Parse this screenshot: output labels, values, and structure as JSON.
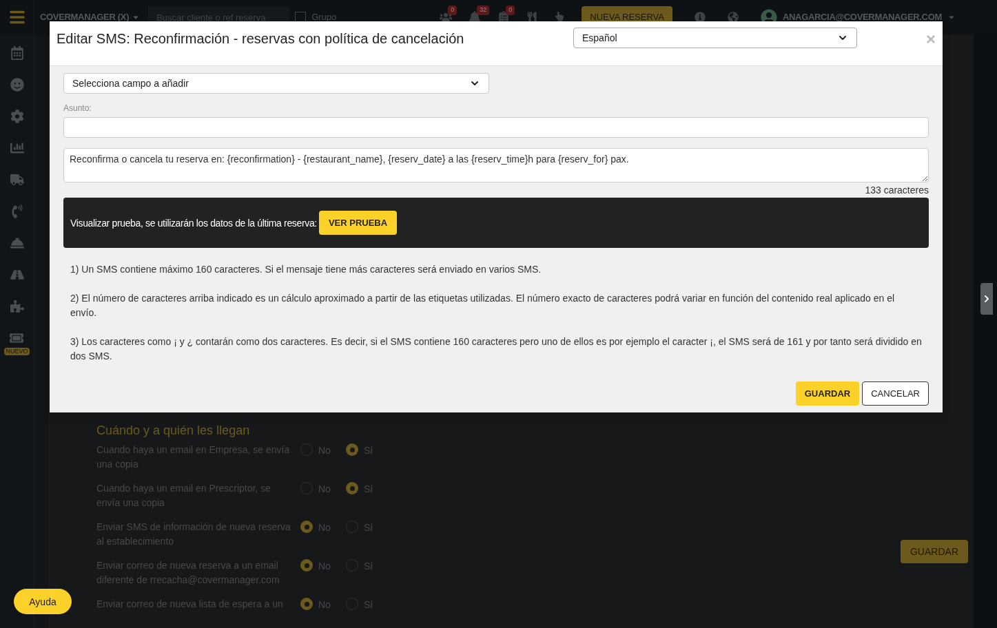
{
  "top_bar": {
    "account": "COVERMANAGER (X)",
    "search": {
      "placeholder": "Buscar cliente o ref reserva"
    },
    "group_checkbox": {
      "label": "Grupo",
      "checked": false
    },
    "badges": [
      {
        "kind": "users",
        "count": "0"
      },
      {
        "kind": "bell",
        "count": "32"
      },
      {
        "kind": "list",
        "count": "0"
      }
    ],
    "new_booking": "NUEVA RESERVA",
    "user": "ANAGARCIA@COVERMANAGER.COM"
  },
  "sidebar": {
    "new_badge": "NUEVO"
  },
  "settings_section": {
    "title": "Cuándo y a quién les llegan",
    "rows": [
      {
        "label": "Cuando haya un email en Empresa, se envía una copia",
        "options": [
          {
            "label": "No",
            "selected": false
          },
          {
            "label": "Sí",
            "selected": true
          }
        ]
      },
      {
        "label": "Cuando haya un email en Prescriptor, se envía una copia",
        "options": [
          {
            "label": "No",
            "selected": false
          },
          {
            "label": "Sí",
            "selected": true
          }
        ]
      },
      {
        "label": "Enviar SMS de información de nueva reserva al establecimiento",
        "options": [
          {
            "label": "No",
            "selected": true
          },
          {
            "label": "Sí",
            "selected": false
          }
        ]
      },
      {
        "label": "Enviar correo de nueva reserva a un email diferente de rrecacha@covermanager.com",
        "options": [
          {
            "label": "No",
            "selected": true
          },
          {
            "label": "Sí",
            "selected": false
          }
        ]
      },
      {
        "label": "Enviar correo de nueva lista de espera a un",
        "options": [
          {
            "label": "No",
            "selected": true
          },
          {
            "label": "Sí",
            "selected": false
          }
        ]
      }
    ],
    "save": "GUARDAR"
  },
  "help_button": "Ayuda",
  "modal": {
    "title": "Editar SMS: Reconfirmación - reservas con política de cancelación",
    "language": "Español",
    "close": "×",
    "field_select": "Selecciona campo a añadir",
    "subject_label": "Asunto:",
    "message": "Reconfirma o cancela tu reserva en: {reconfirmation} - {restaurant_name}, {reserv_date} a las {reserv_time}h para {reserv_for} pax.",
    "char_count": "133 caracteres",
    "preview_text": "Visualizar prueba, se utilizarán los datos de la última reserva:",
    "preview_button": "VER PRUEBA",
    "notes": [
      "1) Un SMS contiene máximo 160 caracteres. Si el mensaje tiene más caracteres será enviado en varios SMS.",
      "2) El número de caracteres arriba indicado es un cálculo aproximado a partir de las etiquetas utilizadas. El número exacto de caracteres podrá variar en función del contenido real aplicado en el envío.",
      "3) Los caracteres como ¡ y ¿ contarán como dos caracteres. Es decir, si el SMS contiene 160 caracteres pero uno de ellos es por ejemplo el caracter ¡, el SMS será de 161 y por tanto será dividido en dos SMS."
    ],
    "save": "GUARDAR",
    "cancel": "CANCELAR"
  }
}
